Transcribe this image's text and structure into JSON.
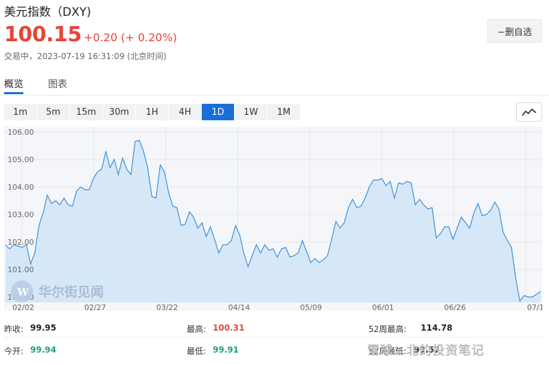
{
  "header": {
    "title": "美元指数（DXY)",
    "price": "100.15",
    "change": "+0.20 (+ 0.20%)",
    "status": "交易中，2023-07-19 16:31:09 (北京时间)",
    "watch_button": "−删自选"
  },
  "tabs": [
    "概览",
    "图表"
  ],
  "periods": [
    "1m",
    "5m",
    "15m",
    "30m",
    "1H",
    "4H",
    "1D",
    "1W",
    "1M"
  ],
  "active_period": "1D",
  "watermark": "华尔街见闻",
  "brand_watermark": "雪球：北的投资笔记",
  "stats": {
    "prev_close_label": "昨收:",
    "prev_close": "99.95",
    "open_label": "今开:",
    "open": "99.94",
    "high_label": "最高:",
    "high": "100.31",
    "low_label": "最低:",
    "low": "99.91",
    "w52_high_label": "52周最高:",
    "w52_high": "114.78",
    "w52_low_label": "52周最低:",
    "w52_low": "99.57"
  },
  "colors": {
    "up": "#e8443a",
    "down": "#1aa37a",
    "accent": "#1a6fd6",
    "line": "#3a8fd8",
    "fill": "#d6e8f8"
  },
  "chart_data": {
    "type": "area",
    "ylim": [
      99.8,
      106.2
    ],
    "y_ticks": [
      "106.00",
      "105.00",
      "104.00",
      "103.00",
      "102.00",
      "101.00",
      "100.00"
    ],
    "x_ticks": [
      "02/02",
      "02/27",
      "03/22",
      "04/14",
      "05/09",
      "06/01",
      "06/26",
      "07/1"
    ],
    "series": [
      {
        "values": [
          101.9,
          101.75,
          101.9,
          101.85,
          101.8,
          101.9,
          101.2,
          101.6,
          102.6,
          103.05,
          103.7,
          103.4,
          103.5,
          103.35,
          103.6,
          103.35,
          103.3,
          103.85,
          104.0,
          103.9,
          103.9,
          104.3,
          104.55,
          104.65,
          105.3,
          104.7,
          105.0,
          104.45,
          105.05,
          104.65,
          104.45,
          105.65,
          105.7,
          105.3,
          104.7,
          103.65,
          103.6,
          104.8,
          104.55,
          103.8,
          103.3,
          103.25,
          102.6,
          102.65,
          103.1,
          102.9,
          102.5,
          102.7,
          102.2,
          102.55,
          102.1,
          101.6,
          101.9,
          101.9,
          102.05,
          102.6,
          102.25,
          101.6,
          101.1,
          101.5,
          101.9,
          101.6,
          101.9,
          101.7,
          101.75,
          101.45,
          101.75,
          101.8,
          101.45,
          101.5,
          101.6,
          102.05,
          101.65,
          101.25,
          101.4,
          101.25,
          101.35,
          101.5,
          102.1,
          102.75,
          102.5,
          102.7,
          103.25,
          103.55,
          103.25,
          103.3,
          103.6,
          104.0,
          104.25,
          104.25,
          104.3,
          104.05,
          104.2,
          103.6,
          104.15,
          104.1,
          104.2,
          104.15,
          103.35,
          103.55,
          103.35,
          103.2,
          103.25,
          102.15,
          102.3,
          102.55,
          102.55,
          102.1,
          102.5,
          102.9,
          102.7,
          102.5,
          103.05,
          103.4,
          102.95,
          103.0,
          103.15,
          103.45,
          103.2,
          102.35,
          102.05,
          101.8,
          100.7,
          99.85,
          100.05,
          100.0,
          100.0,
          100.1,
          100.2
        ]
      }
    ]
  }
}
